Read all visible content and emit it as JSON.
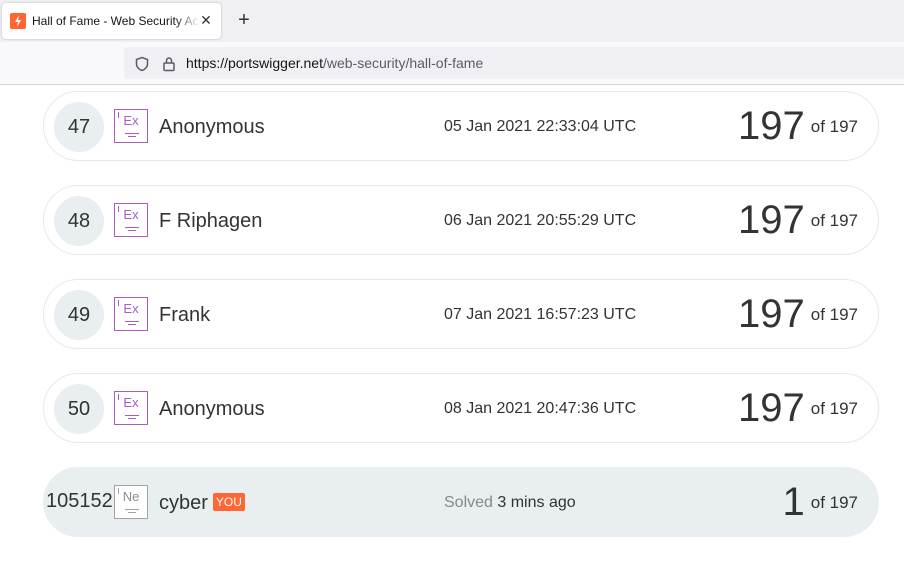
{
  "browser": {
    "tab_title": "Hall of Fame - Web Security Academy",
    "url_host": "https://portswigger.net",
    "url_path": "/web-security/hall-of-fame",
    "new_tab": "+",
    "close": "✕"
  },
  "rows": [
    {
      "rank": "47",
      "badge": "Ex",
      "name": "Anonymous",
      "date": "05 Jan 2021 22:33:04 UTC",
      "score": "197",
      "of": "of 197"
    },
    {
      "rank": "48",
      "badge": "Ex",
      "name": "F Riphagen",
      "date": "06 Jan 2021 20:55:29 UTC",
      "score": "197",
      "of": "of 197"
    },
    {
      "rank": "49",
      "badge": "Ex",
      "name": "Frank",
      "date": "07 Jan 2021 16:57:23 UTC",
      "score": "197",
      "of": "of 197"
    },
    {
      "rank": "50",
      "badge": "Ex",
      "name": "Anonymous",
      "date": "08 Jan 2021 20:47:36 UTC",
      "score": "197",
      "of": "of 197"
    }
  ],
  "you_row": {
    "rank": "105152",
    "badge": "Ne",
    "name": "cyber",
    "you_label": "YOU",
    "solved_label": "Solved",
    "solved_time": "3 mins ago",
    "score": "1",
    "of": "of 197"
  },
  "colors": {
    "accent": "#ff6633",
    "expert_badge": "#a95cc4",
    "you_row_bg": "#e9eef0"
  },
  "icons": [
    "shield-icon",
    "lock-icon",
    "favicon-icon",
    "close-icon",
    "plus-icon"
  ]
}
